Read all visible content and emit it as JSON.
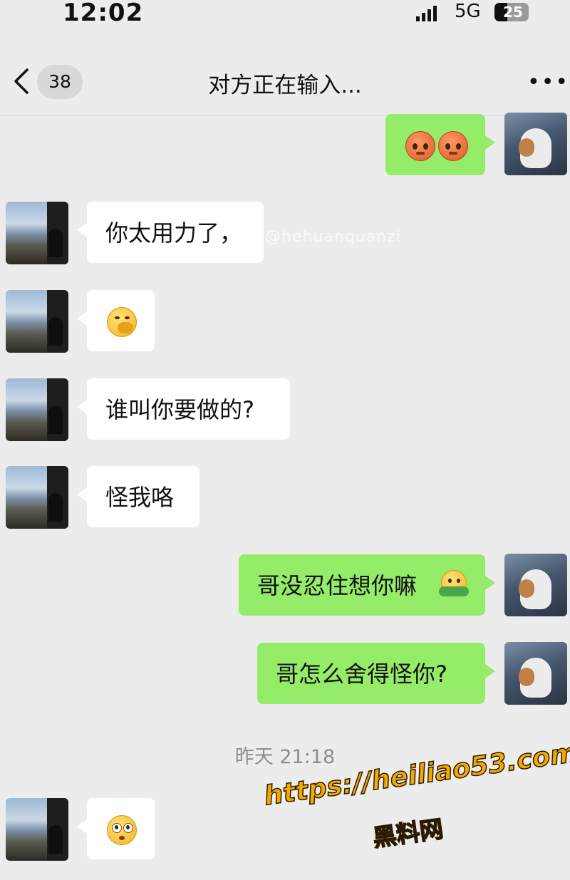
{
  "status_bar": {
    "time": "12:02",
    "network": "5G",
    "battery": "25"
  },
  "header": {
    "unread_count": "38",
    "title": "对方正在输入...",
    "more_label": "•••"
  },
  "messages": [
    {
      "sender": "me",
      "content": "emoji",
      "emoji": [
        "angry-face-icon",
        "angry-face-icon"
      ]
    },
    {
      "sender": "them",
      "text": "你太用力了，"
    },
    {
      "sender": "them",
      "content": "emoji",
      "emoji": [
        "hand-over-mouth-face-icon"
      ]
    },
    {
      "sender": "them",
      "text": "谁叫你要做的?"
    },
    {
      "sender": "them",
      "text": "怪我咯"
    },
    {
      "sender": "me",
      "text": "哥没忍住想你嘛",
      "emoji": [
        "hug-face-icon"
      ]
    },
    {
      "sender": "me",
      "text": "哥怎么舍得怪你?"
    },
    {
      "sender": "them",
      "content": "emoji",
      "emoji": [
        "flushed-face-icon"
      ]
    }
  ],
  "timestamp": "昨天 21:18",
  "overlays": {
    "watermark": "@hehuanquanzi",
    "url": "https://heiliao53.com",
    "site_name": "黑料网"
  },
  "colors": {
    "outgoing_bubble": "#95ec69",
    "incoming_bubble": "#ffffff",
    "background": "#ececec",
    "overlay_text": "#f6a800"
  }
}
